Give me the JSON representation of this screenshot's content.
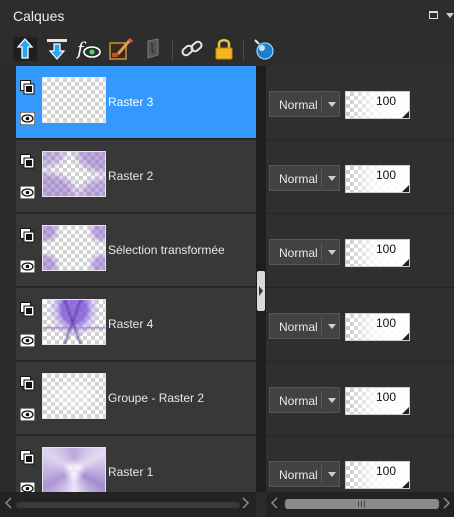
{
  "panel": {
    "title": "Calques"
  },
  "toolbar": {
    "buttons": [
      {
        "icon": "move-layer-up-icon"
      },
      {
        "icon": "move-layer-down-icon"
      },
      {
        "icon": "layer-effects-visibility-icon"
      },
      {
        "icon": "brush-mask-icon"
      },
      {
        "icon": "lock-transparency-icon"
      },
      {
        "icon": "link-layers-icon"
      },
      {
        "icon": "lock-layer-icon"
      },
      {
        "icon": "layer-style-icon"
      }
    ]
  },
  "layers": [
    {
      "name": "Raster 3",
      "selected": true,
      "blend": "Normal",
      "opacity": "100"
    },
    {
      "name": "Raster 2",
      "selected": false,
      "blend": "Normal",
      "opacity": "100"
    },
    {
      "name": "Sélection transformée",
      "selected": false,
      "blend": "Normal",
      "opacity": "100"
    },
    {
      "name": "Raster 4",
      "selected": false,
      "blend": "Normal",
      "opacity": "100"
    },
    {
      "name": "Groupe - Raster 2",
      "selected": false,
      "blend": "Normal",
      "opacity": "100"
    },
    {
      "name": "Raster 1",
      "selected": false,
      "blend": "Normal",
      "opacity": "100"
    }
  ],
  "colors": {
    "selection": "#3399ff",
    "row_bg": "#383838",
    "panel_bg": "#2b2b2b",
    "accent_purple": "#9b7fd6"
  }
}
